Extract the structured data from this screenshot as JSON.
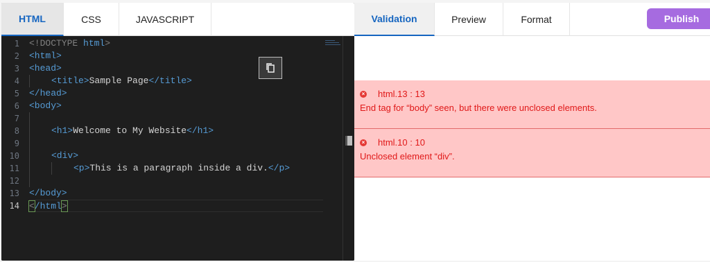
{
  "editor_tabs": [
    "HTML",
    "CSS",
    "JAVASCRIPT"
  ],
  "preview_tabs": [
    "Validation",
    "Preview",
    "Format"
  ],
  "publish_label": "Publish",
  "line_numbers": [
    "1",
    "2",
    "3",
    "4",
    "5",
    "6",
    "7",
    "8",
    "9",
    "10",
    "11",
    "12",
    "13",
    "14"
  ],
  "code": {
    "l1a": "<!DOCTYPE ",
    "l1b": "html",
    "l1c": ">",
    "l2": "<html>",
    "l3": "<head>",
    "l4a": "<title>",
    "l4b": "Sample Page",
    "l4c": "</title>",
    "l5": "</head>",
    "l6": "<body>",
    "l8a": "<h1>",
    "l8b": "Welcome to My Website",
    "l8c": "</h1>",
    "l10": "<div>",
    "l11a": "<p>",
    "l11b": "This is a paragraph inside a div.",
    "l11c": "</p>",
    "l13": "</body>",
    "l14a": "<",
    "l14b": "/html",
    "l14c": ">"
  },
  "errors": [
    {
      "location": "html.13 : 13",
      "message": "End tag for “body” seen, but there were unclosed elements."
    },
    {
      "location": "html.10 : 10",
      "message": "Unclosed element “div”."
    }
  ],
  "icons": {
    "copy": "copy-icon",
    "error": "error-circle-icon"
  },
  "colors": {
    "accent": "#1565c0",
    "publish": "#a66be0",
    "error_bg": "#ffc7c7",
    "error_text": "#e01818"
  }
}
